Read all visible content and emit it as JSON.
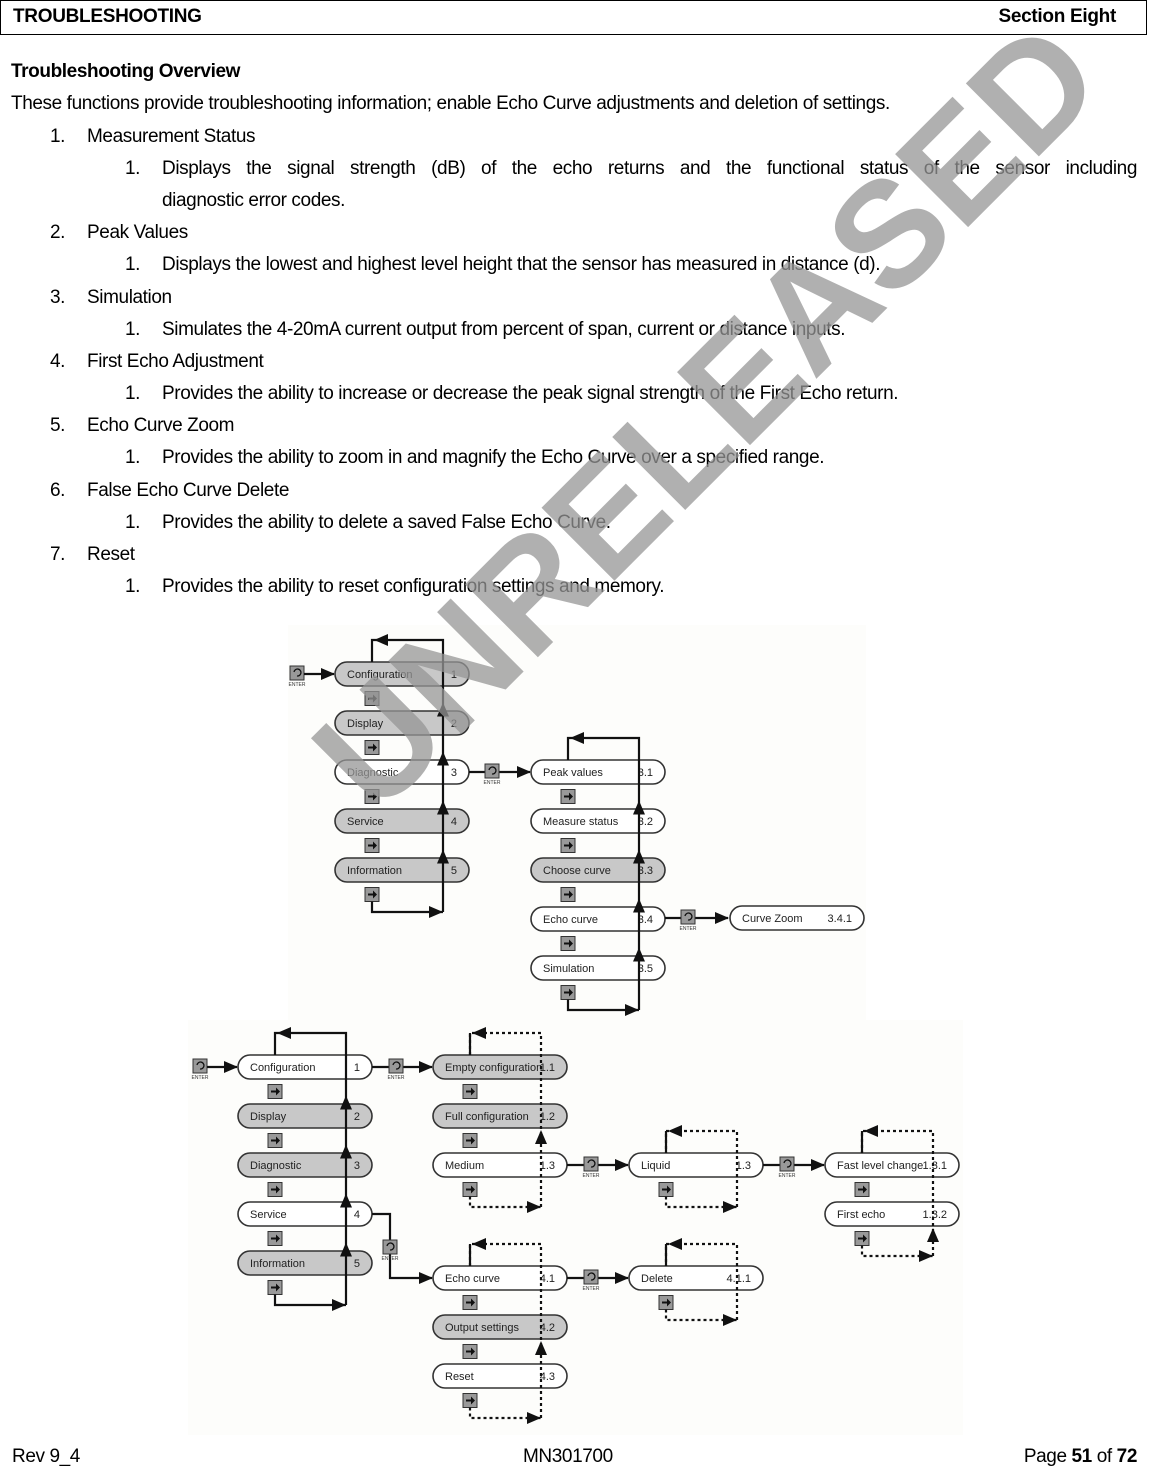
{
  "header": {
    "left": "TROUBLESHOOTING",
    "right": "Section Eight"
  },
  "overview": {
    "title": "Troubleshooting Overview",
    "intro": "These functions provide troubleshooting information; enable Echo Curve adjustments and deletion of settings."
  },
  "items": [
    {
      "num": "1.",
      "label": "Measurement Status",
      "sub_num": "1.",
      "sub": "Displays the signal strength (dB) of the echo returns and the functional status of the sensor including",
      "sub_cont": "diagnostic error codes."
    },
    {
      "num": "2.",
      "label": "Peak Values",
      "sub_num": "1.",
      "sub": "Displays the lowest and highest level height that the sensor has measured in distance (d)."
    },
    {
      "num": "3.",
      "label": "Simulation",
      "sub_num": "1.",
      "sub": "Simulates the 4-20mA current output from percent of span, current or distance inputs."
    },
    {
      "num": "4.",
      "label": "First Echo Adjustment",
      "sub_num": "1.",
      "sub": "Provides the ability to increase or decrease the peak signal strength of the First Echo return."
    },
    {
      "num": "5.",
      "label": "Echo Curve Zoom",
      "sub_num": "1.",
      "sub": "Provides the ability to zoom in and magnify the Echo Curve over a specified range."
    },
    {
      "num": "6.",
      "label": "False Echo Curve Delete",
      "sub_num": "1.",
      "sub": "Provides the ability to delete a saved False Echo Curve."
    },
    {
      "num": "7.",
      "label": "Reset",
      "sub_num": "1.",
      "sub": "Provides the ability to reset configuration settings and memory."
    }
  ],
  "diagram1": {
    "enter_label": "ENTER",
    "main": [
      {
        "label": "Configuration",
        "num": "1",
        "shaded": true
      },
      {
        "label": "Display",
        "num": "2",
        "shaded": true
      },
      {
        "label": "Diagnostic",
        "num": "3",
        "shaded": false
      },
      {
        "label": "Service",
        "num": "4",
        "shaded": true
      },
      {
        "label": "Information",
        "num": "5",
        "shaded": true
      }
    ],
    "diag": [
      {
        "label": "Peak values",
        "num": "3.1",
        "shaded": false
      },
      {
        "label": "Measure status",
        "num": "3.2",
        "shaded": false
      },
      {
        "label": "Choose curve",
        "num": "3.3",
        "shaded": true
      },
      {
        "label": "Echo curve",
        "num": "3.4",
        "shaded": false
      },
      {
        "label": "Simulation",
        "num": "3.5",
        "shaded": false
      }
    ],
    "zoom": {
      "label": "Curve Zoom",
      "num": "3.4.1"
    }
  },
  "diagram2": {
    "enter_label": "ENTER",
    "main": [
      {
        "label": "Configuration",
        "num": "1",
        "shaded": false
      },
      {
        "label": "Display",
        "num": "2",
        "shaded": true
      },
      {
        "label": "Diagnostic",
        "num": "3",
        "shaded": true
      },
      {
        "label": "Service",
        "num": "4",
        "shaded": false
      },
      {
        "label": "Information",
        "num": "5",
        "shaded": true
      }
    ],
    "config": [
      {
        "label": "Empty configuration",
        "num": "1.1",
        "shaded": true
      },
      {
        "label": "Full configuration",
        "num": "1.2",
        "shaded": true
      },
      {
        "label": "Medium",
        "num": "1.3",
        "shaded": false
      }
    ],
    "liquid": {
      "label": "Liquid",
      "num": "1.3"
    },
    "liquid_sub": [
      {
        "label": "Fast level change",
        "num": "1.3.1"
      },
      {
        "label": "First echo",
        "num": "1.3.2"
      }
    ],
    "service": [
      {
        "label": "Echo curve",
        "num": "4.1",
        "shaded": false
      },
      {
        "label": "Output settings",
        "num": "4.2",
        "shaded": true
      },
      {
        "label": "Reset",
        "num": "4.3",
        "shaded": false
      }
    ],
    "delete": {
      "label": "Delete",
      "num": "4.1.1"
    }
  },
  "watermark": "UNRELEASED",
  "footer": {
    "left": "Rev 9_4",
    "center": "MN301700",
    "page_prefix": "Page ",
    "page": "51",
    "of": " of ",
    "total": "72"
  }
}
